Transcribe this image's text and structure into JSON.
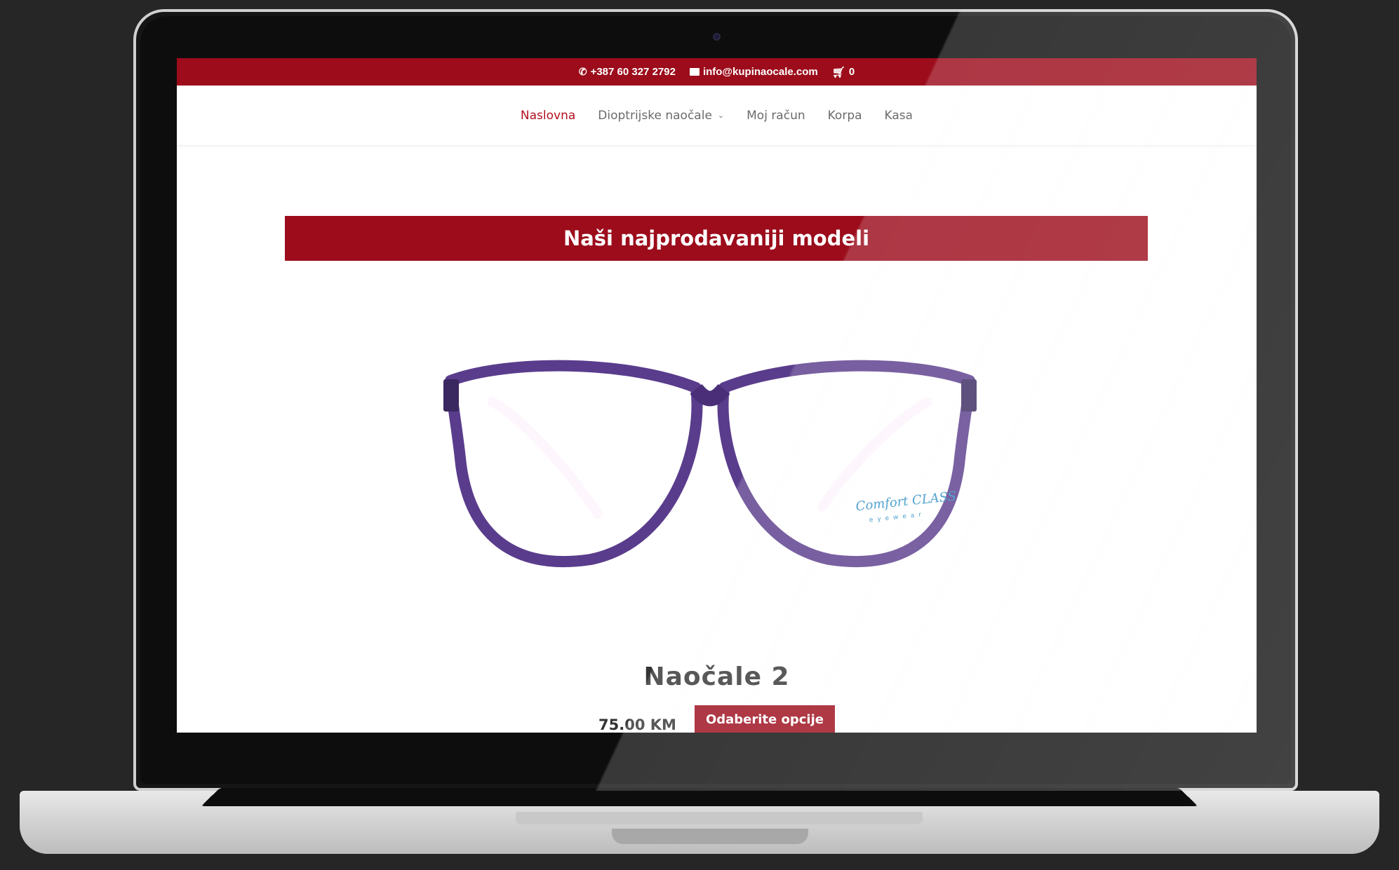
{
  "topbar": {
    "phone": "+387 60 327 2792",
    "email": "info@kupinaocale.com",
    "cart_count": "0"
  },
  "nav": {
    "items": [
      {
        "label": "Naslovna",
        "active": true
      },
      {
        "label": "Dioptrijske naočale",
        "has_dropdown": true
      },
      {
        "label": "Moj račun"
      },
      {
        "label": "Korpa"
      },
      {
        "label": "Kasa"
      }
    ]
  },
  "banner": {
    "title": "Naši najprodavaniji modeli"
  },
  "product": {
    "name": "Naočale 2",
    "price": "75.00 KM",
    "button_label": "Odaberite opcije",
    "image_brand": "Comfort CLASS",
    "image_brand_sub": "eyewear"
  },
  "colors": {
    "brand": "#9c0c1b",
    "frame": "#5a3c8c",
    "temple": "#d884d8"
  }
}
